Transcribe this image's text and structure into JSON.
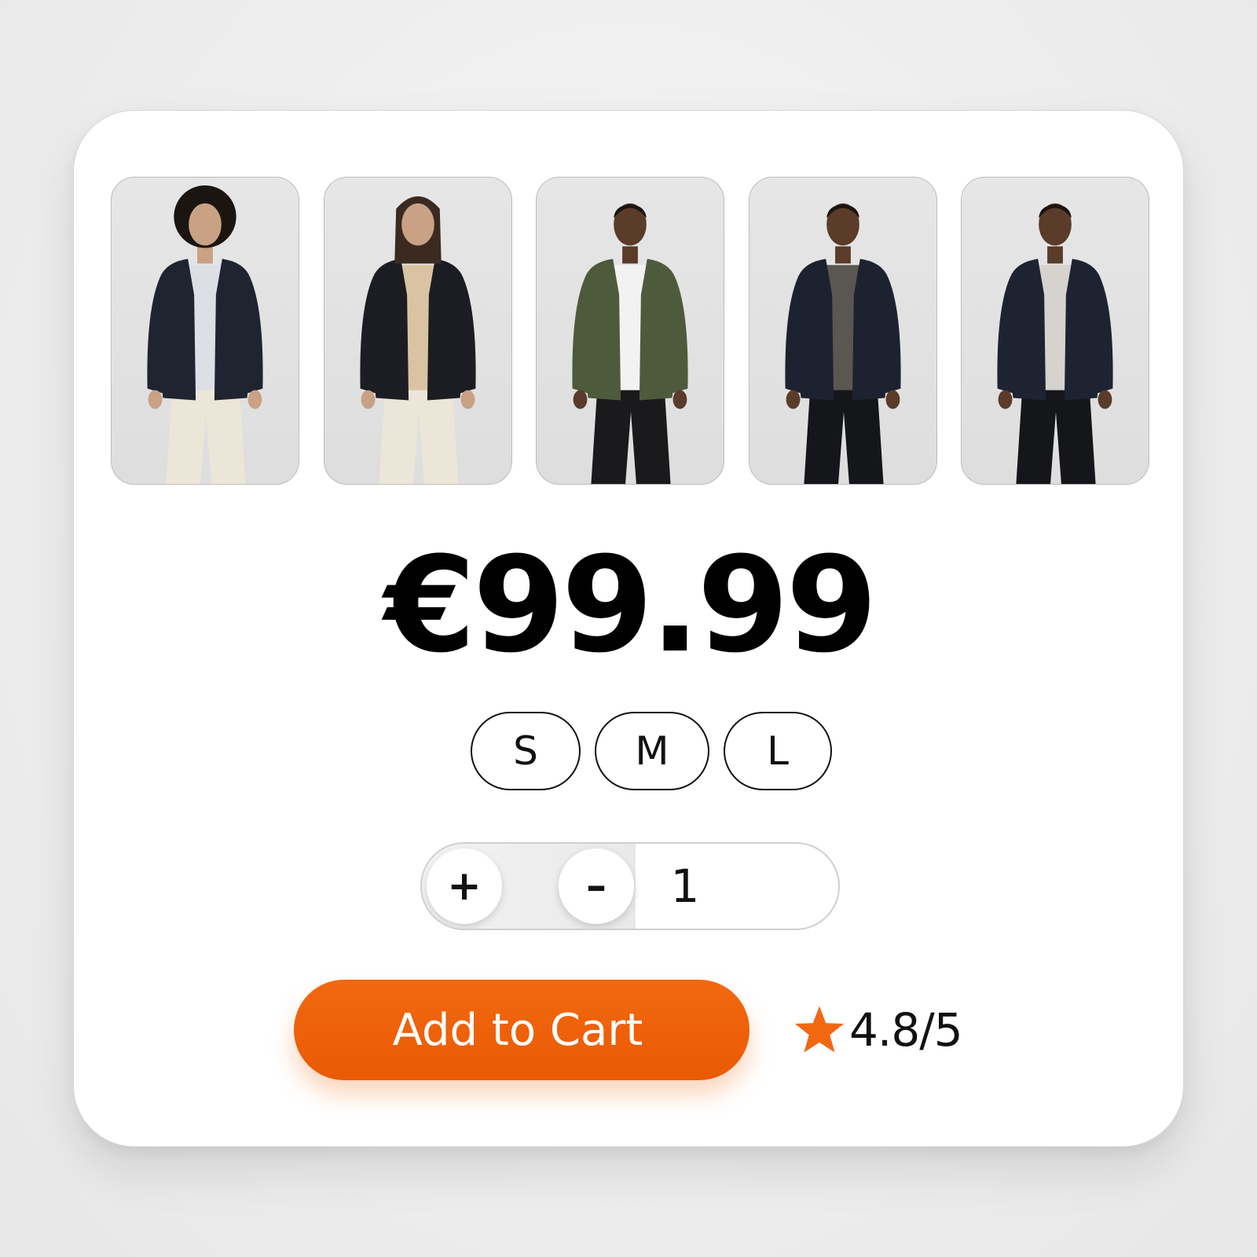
{
  "product": {
    "gallery": [
      {
        "name": "model-1",
        "jacket_color": "#1f2430",
        "pants_color": "#ece6d8",
        "inner_color": "#dcdfe6"
      },
      {
        "name": "model-2",
        "jacket_color": "#1c1d22",
        "pants_color": "#ece6d8",
        "inner_color": "#d9c3a3"
      },
      {
        "name": "model-3",
        "jacket_color": "#4e5a3c",
        "pants_color": "#1a1a1d",
        "inner_color": "#f2f2f2"
      },
      {
        "name": "model-4",
        "jacket_color": "#1d2230",
        "pants_color": "#15161a",
        "inner_color": "#5a5650"
      },
      {
        "name": "model-5",
        "jacket_color": "#1e2332",
        "pants_color": "#15161a",
        "inner_color": "#d6d3ce"
      }
    ],
    "price": "€99.99",
    "sizes": [
      "S",
      "M",
      "L"
    ],
    "quantity": {
      "plus_label": "+",
      "minus_label": "–",
      "value": "1"
    },
    "add_to_cart_label": "Add to Cart",
    "rating_text": "4.8/5"
  },
  "colors": {
    "accent": "#f26810",
    "star": "#f26810",
    "text": "#111111"
  },
  "icons": {
    "rating": "star-icon"
  }
}
